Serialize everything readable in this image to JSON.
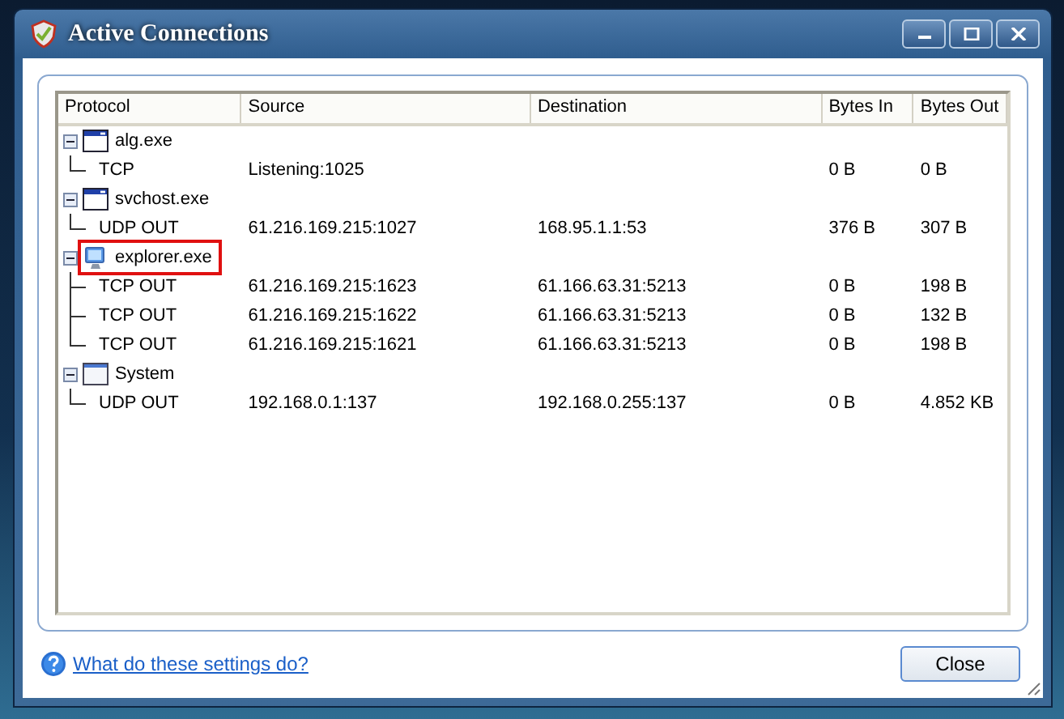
{
  "window": {
    "title": "Active Connections"
  },
  "table": {
    "columns": [
      "Protocol",
      "Source",
      "Destination",
      "Bytes In",
      "Bytes Out"
    ],
    "processes": [
      {
        "name": "alg.exe",
        "kind": "window",
        "expanded": true,
        "highlighted": false,
        "connections": [
          {
            "protocol": "TCP",
            "source": "Listening:1025",
            "bytes_in": "0 B",
            "bytes_out": "0 B"
          }
        ]
      },
      {
        "name": "svchost.exe",
        "kind": "window",
        "expanded": true,
        "highlighted": false,
        "connections": [
          {
            "protocol": "UDP OUT",
            "source": "61.216.169.215:1027",
            "destination": "168.95.1.1:53",
            "bytes_in": "376 B",
            "bytes_out": "307 B"
          }
        ]
      },
      {
        "name": "explorer.exe",
        "kind": "monitor",
        "expanded": true,
        "highlighted": true,
        "connections": [
          {
            "protocol": "TCP OUT",
            "source": "61.216.169.215:1623",
            "destination": "61.166.63.31:5213",
            "bytes_in": "0 B",
            "bytes_out": "198 B"
          },
          {
            "protocol": "TCP OUT",
            "source": "61.216.169.215:1622",
            "destination": "61.166.63.31:5213",
            "bytes_in": "0 B",
            "bytes_out": "132 B"
          },
          {
            "protocol": "TCP OUT",
            "source": "61.216.169.215:1621",
            "destination": "61.166.63.31:5213",
            "bytes_in": "0 B",
            "bytes_out": "198 B"
          }
        ]
      },
      {
        "name": "System",
        "kind": "blank-window",
        "expanded": true,
        "highlighted": false,
        "connections": [
          {
            "protocol": "UDP OUT",
            "source": "192.168.0.1:137",
            "destination": "192.168.0.255:137",
            "bytes_in": "0 B",
            "bytes_out": "4.852 KB"
          }
        ]
      }
    ]
  },
  "help_link": "What do these settings do?",
  "buttons": [
    "Close"
  ]
}
